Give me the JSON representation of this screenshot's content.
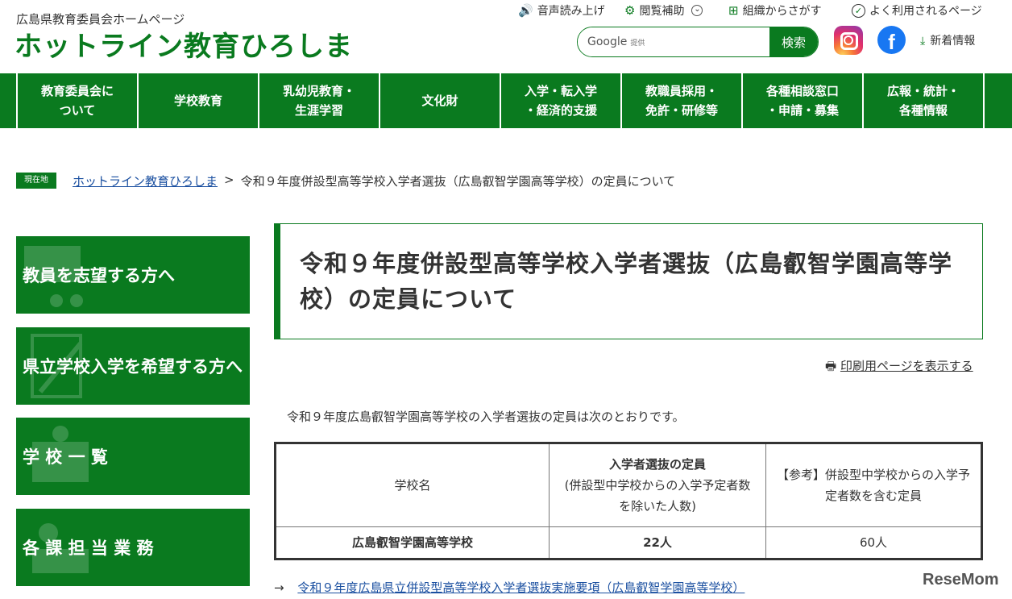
{
  "header": {
    "subtitle": "広島県教育委員会ホームページ",
    "title": "ホットライン教育ひろしま",
    "utils": [
      {
        "icon": "speaker-icon",
        "glyph": "🔊",
        "label": "音声読み上げ"
      },
      {
        "icon": "gear-icon",
        "glyph": "⚙",
        "label": "閲覧補助",
        "extra": "⌄"
      },
      {
        "icon": "org-chart-icon",
        "glyph": "⊞",
        "label": "組織からさがす"
      },
      {
        "icon": "check-icon",
        "glyph": "✓",
        "label": "よく利用されるページ"
      }
    ],
    "search": {
      "brand": "Google",
      "brand_sub": "提供",
      "placeholder": "",
      "button": "検索"
    },
    "new_info": "新着情報",
    "fb_glyph": "f"
  },
  "gnav": [
    "教育委員会に\nついて",
    "学校教育",
    "乳幼児教育・\n生涯学習",
    "文化財",
    "入学・転入学\n・経済的支援",
    "教職員採用・\n免許・研修等",
    "各種相談窓口\n・申請・募集",
    "広報・統計・\n各種情報"
  ],
  "breadcrumb": {
    "badge": "現在地",
    "home": "ホットライン教育ひろしま",
    "sep": ">",
    "current": "令和９年度併設型高等学校入学者選抜（広島叡智学園高等学校）の定員について"
  },
  "side": [
    "教員を志望する方へ",
    "県立学校入学を希望する方へ",
    "学 校 一 覧",
    "各 課 担 当 業 務"
  ],
  "main": {
    "title": "令和９年度併設型高等学校入学者選抜（広島叡智学園高等学校）の定員について",
    "print": "印刷用ページを表示する",
    "lead": "令和９年度広島叡智学園高等学校の入学者選抜の定員は次のとおりです。",
    "table": {
      "h1": "学校名",
      "h2_bold": "入学者選抜の定員",
      "h2_note": "(併設型中学校からの入学予定者数を除いた人数)",
      "h3": "【参考】併設型中学校からの入学予定者数を含む定員",
      "school": "広島叡智学園高等学校",
      "quota": "22人",
      "ref": "60人"
    },
    "link_arrow": "→",
    "link": "令和９年度広島県立併設型高等学校入学者選抜実施要項（広島叡智学園高等学校）"
  },
  "watermark": "ReseMom"
}
